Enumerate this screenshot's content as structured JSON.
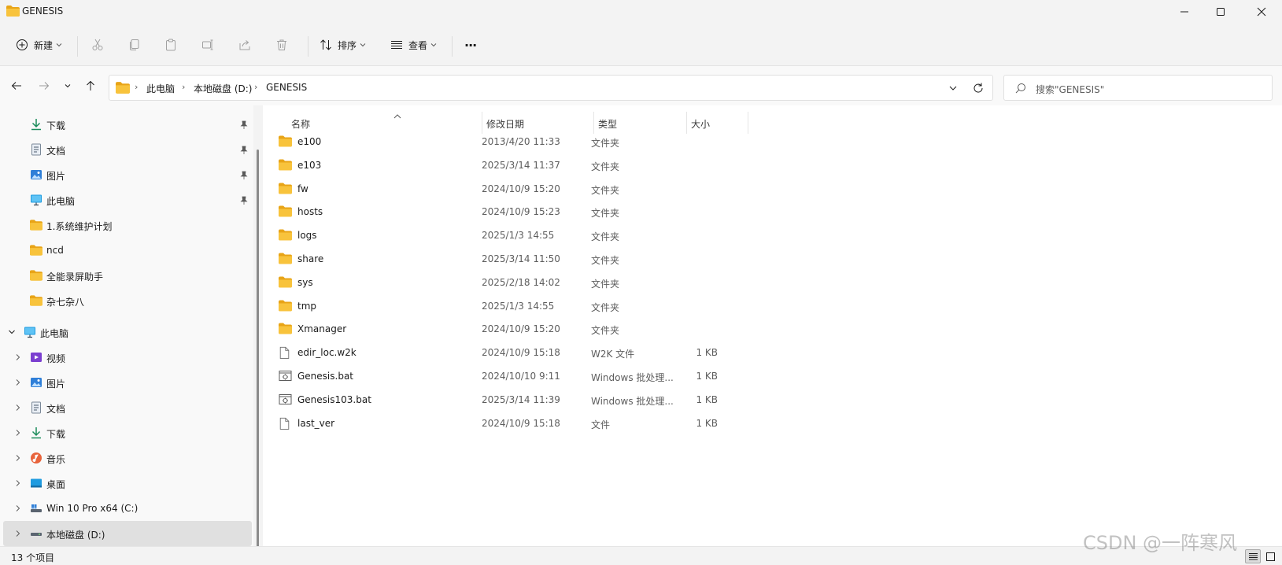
{
  "window": {
    "title": "GENESIS",
    "minimize_icon": "minimize-icon",
    "maximize_icon": "maximize-icon",
    "close_icon": "close-icon"
  },
  "toolbar": {
    "new_label": "新建",
    "sort_label": "排序",
    "view_label": "查看",
    "more_label": "···"
  },
  "address": {
    "crumbs": [
      "此电脑",
      "本地磁盘 (D:)",
      "GENESIS"
    ],
    "search_placeholder": "搜索\"GENESIS\""
  },
  "sidebar": {
    "quick_access": [
      {
        "label": "下载",
        "icon": "download-icon",
        "pinned": true
      },
      {
        "label": "文档",
        "icon": "document-icon",
        "pinned": true
      },
      {
        "label": "图片",
        "icon": "picture-icon",
        "pinned": true
      },
      {
        "label": "此电脑",
        "icon": "computer-icon",
        "pinned": true
      },
      {
        "label": "1.系统维护计划",
        "icon": "folder-icon",
        "pinned": false
      },
      {
        "label": "ncd",
        "icon": "folder-icon",
        "pinned": false
      },
      {
        "label": "全能录屏助手",
        "icon": "folder-icon",
        "pinned": false
      },
      {
        "label": "杂七杂八",
        "icon": "folder-icon",
        "pinned": false
      }
    ],
    "this_pc": {
      "label": "此电脑",
      "icon": "computer-icon",
      "expanded": true
    },
    "this_pc_children": [
      {
        "label": "视频",
        "icon": "video-icon"
      },
      {
        "label": "图片",
        "icon": "picture-icon"
      },
      {
        "label": "文档",
        "icon": "document-icon"
      },
      {
        "label": "下载",
        "icon": "download-icon"
      },
      {
        "label": "音乐",
        "icon": "music-icon"
      },
      {
        "label": "桌面",
        "icon": "desktop-icon"
      },
      {
        "label": "Win 10 Pro x64 (C:)",
        "icon": "drive-icon"
      },
      {
        "label": "本地磁盘 (D:)",
        "icon": "drive-icon",
        "selected": true
      }
    ]
  },
  "list": {
    "columns": [
      "名称",
      "修改日期",
      "类型",
      "大小"
    ],
    "rows": [
      {
        "name": "e100",
        "date": "2013/4/20 11:33",
        "type": "文件夹",
        "size": "",
        "icon": "folder-icon"
      },
      {
        "name": "e103",
        "date": "2025/3/14 11:37",
        "type": "文件夹",
        "size": "",
        "icon": "folder-icon"
      },
      {
        "name": "fw",
        "date": "2024/10/9 15:20",
        "type": "文件夹",
        "size": "",
        "icon": "folder-icon"
      },
      {
        "name": "hosts",
        "date": "2024/10/9 15:23",
        "type": "文件夹",
        "size": "",
        "icon": "folder-icon"
      },
      {
        "name": "logs",
        "date": "2025/1/3 14:55",
        "type": "文件夹",
        "size": "",
        "icon": "folder-icon"
      },
      {
        "name": "share",
        "date": "2025/3/14 11:50",
        "type": "文件夹",
        "size": "",
        "icon": "folder-icon"
      },
      {
        "name": "sys",
        "date": "2025/2/18 14:02",
        "type": "文件夹",
        "size": "",
        "icon": "folder-icon"
      },
      {
        "name": "tmp",
        "date": "2025/1/3 14:55",
        "type": "文件夹",
        "size": "",
        "icon": "folder-icon"
      },
      {
        "name": "Xmanager",
        "date": "2024/10/9 15:20",
        "type": "文件夹",
        "size": "",
        "icon": "folder-icon"
      },
      {
        "name": "edir_loc.w2k",
        "date": "2024/10/9 15:18",
        "type": "W2K 文件",
        "size": "1 KB",
        "icon": "file-icon"
      },
      {
        "name": "Genesis.bat",
        "date": "2024/10/10 9:11",
        "type": "Windows 批处理...",
        "size": "1 KB",
        "icon": "batch-file-icon"
      },
      {
        "name": "Genesis103.bat",
        "date": "2025/3/14 11:39",
        "type": "Windows 批处理...",
        "size": "1 KB",
        "icon": "batch-file-icon"
      },
      {
        "name": "last_ver",
        "date": "2024/10/9 15:18",
        "type": "文件",
        "size": "1 KB",
        "icon": "file-icon"
      }
    ]
  },
  "status": {
    "item_count": "13 个项目"
  },
  "watermark": "CSDN @一阵寒风",
  "colors": {
    "folder": "#f8c33c",
    "folder_dark": "#e8a417",
    "selected_bg": "#e0e0e0",
    "accent": "#0067c0"
  }
}
